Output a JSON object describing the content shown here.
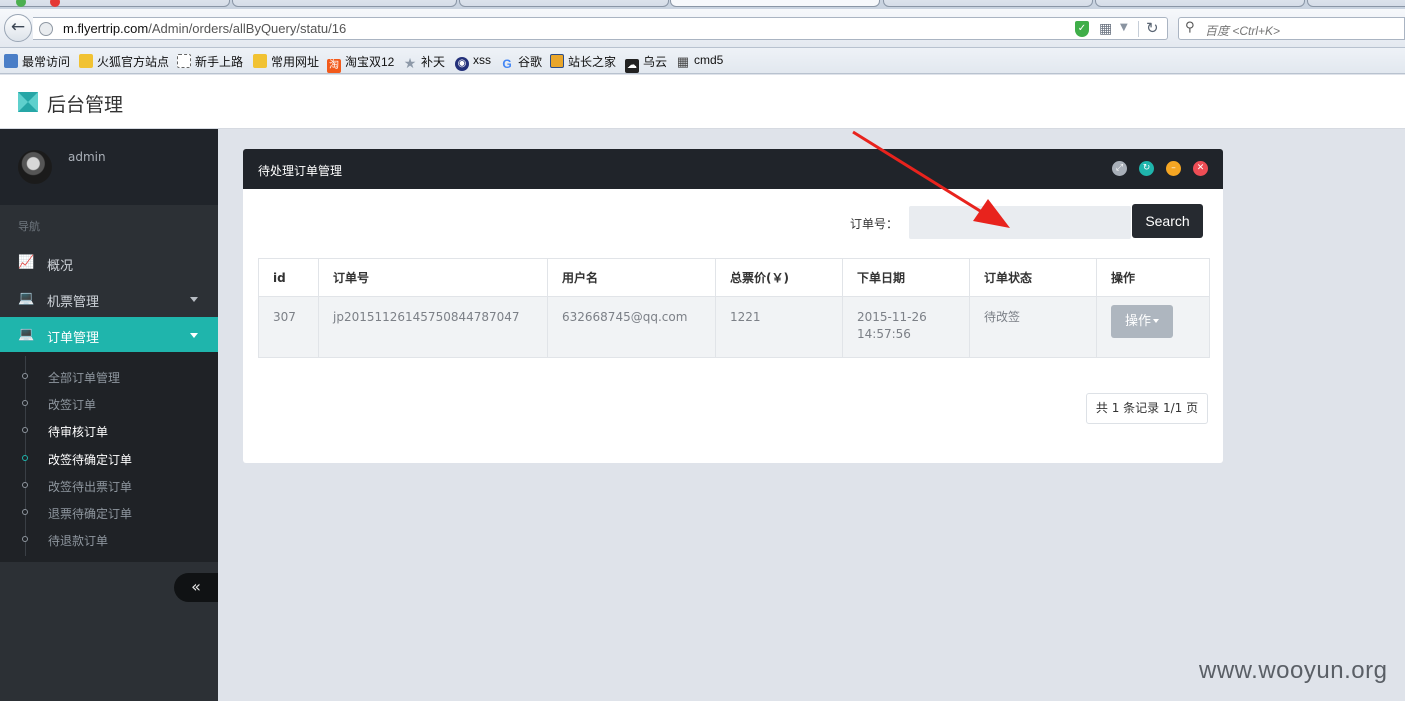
{
  "browser": {
    "url_host": "m.flyertrip.com",
    "url_path": "/Admin/orders/allByQuery/statu/16",
    "search_placeholder": "百度 <Ctrl+K>",
    "bookmarks": [
      {
        "label": "最常访问",
        "icon": "bookmark-page-icon",
        "color": "#4a7ec7"
      },
      {
        "label": "火狐官方站点",
        "icon": "folder-icon",
        "color": "#f1c232"
      },
      {
        "label": "新手上路",
        "icon": "dashed-page-icon",
        "color": "#ffffff"
      },
      {
        "label": "常用网址",
        "icon": "folder-icon",
        "color": "#f1c232"
      },
      {
        "label": "淘宝双12",
        "icon": "taobao-icon",
        "color": "#f25a1b"
      },
      {
        "label": "补天",
        "icon": "star-icon",
        "color": "#8d99a8"
      },
      {
        "label": "xss",
        "icon": "xss-icon",
        "color": "#23307a"
      },
      {
        "label": "谷歌",
        "icon": "google-icon",
        "color": "#ffffff"
      },
      {
        "label": "站长之家",
        "icon": "chinaz-icon",
        "color": "#e9a62b"
      },
      {
        "label": "乌云",
        "icon": "wooyun-icon",
        "color": "#222222"
      },
      {
        "label": "cmd5",
        "icon": "grid-icon",
        "color": "#444444"
      }
    ]
  },
  "app": {
    "title": "后台管理"
  },
  "sidebar": {
    "user": "admin",
    "nav_heading": "导航",
    "menu": [
      {
        "label": "概况",
        "icon": "chart-icon"
      },
      {
        "label": "机票管理",
        "icon": "laptop-icon"
      },
      {
        "label": "订单管理",
        "icon": "laptop-icon"
      }
    ],
    "submenu": [
      {
        "label": "全部订单管理"
      },
      {
        "label": "改签订单"
      },
      {
        "label": "待审核订单"
      },
      {
        "label": "改签待确定订单"
      },
      {
        "label": "改签待出票订单"
      },
      {
        "label": "退票待确定订单"
      },
      {
        "label": "待退款订单"
      }
    ],
    "collapse_label": "«"
  },
  "panel": {
    "title": "待处理订单管理",
    "search_label": "订单号：",
    "search_value": "",
    "search_button": "Search",
    "table": {
      "headers": [
        "id",
        "订单号",
        "用户名",
        "总票价(￥)",
        "下单日期",
        "订单状态",
        "操作"
      ],
      "rows": [
        {
          "id": "307",
          "order_no": "jp20151126145750844787047",
          "user": "632668745@qq.com",
          "price": "1221",
          "date": "2015-11-26",
          "time": "14:57:56",
          "status": "待改签",
          "action": "操作"
        }
      ]
    },
    "pagination": "共 1 条记录 1/1 页"
  },
  "watermark": "www.wooyun.org",
  "colors": {
    "accent": "#1fb5ac",
    "sidebar": "#2c3035",
    "panel_head": "#20242a",
    "annotation_arrow": "#e8231d"
  }
}
